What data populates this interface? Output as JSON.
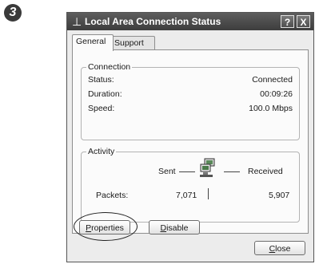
{
  "step_number": "3",
  "window": {
    "title": "Local Area Connection Status",
    "help_label": "?",
    "close_label": "X",
    "app_icon": "network-icon"
  },
  "tabs": [
    {
      "label": "General",
      "active": true
    },
    {
      "label": "Support",
      "active": false
    }
  ],
  "connection": {
    "legend": "Connection",
    "rows": [
      {
        "label": "Status:",
        "value": "Connected"
      },
      {
        "label": "Duration:",
        "value": "00:09:26"
      },
      {
        "label": "Speed:",
        "value": "100.0 Mbps"
      }
    ]
  },
  "activity": {
    "legend": "Activity",
    "sent_label": "Sent",
    "received_label": "Received",
    "packets_label": "Packets:",
    "packets_sent": "7,071",
    "packets_received": "5,907"
  },
  "buttons": {
    "properties": {
      "first": "P",
      "rest": "roperties"
    },
    "disable": {
      "first": "D",
      "rest": "isable"
    },
    "close": {
      "first": "C",
      "rest": "lose"
    }
  }
}
